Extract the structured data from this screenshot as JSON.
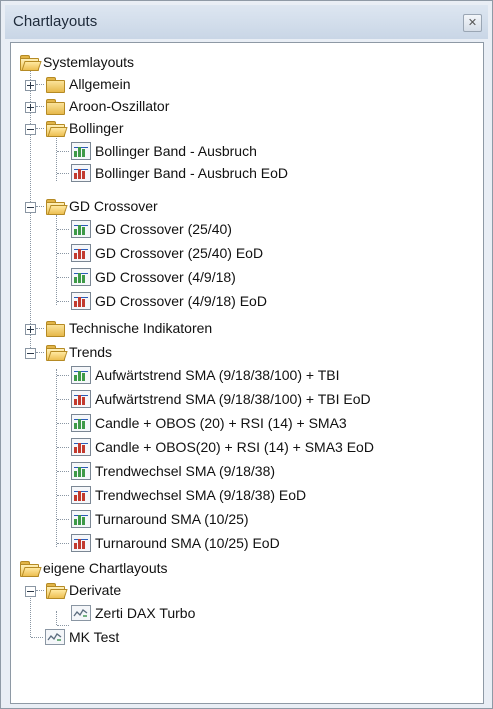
{
  "window": {
    "title": "Chartlayouts"
  },
  "tree": {
    "root_system": "Systemlayouts",
    "allgemein": "Allgemein",
    "aroon": "Aroon-Oszillator",
    "bollinger": {
      "label": "Bollinger",
      "items": [
        "Bollinger Band - Ausbruch",
        "Bollinger Band - Ausbruch EoD"
      ]
    },
    "gd": {
      "label": "GD Crossover",
      "items": [
        "GD Crossover (25/40)",
        "GD Crossover (25/40) EoD",
        "GD Crossover (4/9/18)",
        "GD Crossover (4/9/18) EoD"
      ]
    },
    "technische": "Technische Indikatoren",
    "trends": {
      "label": "Trends",
      "items": [
        "Aufwärtstrend SMA (9/18/38/100) + TBI",
        "Aufwärtstrend SMA (9/18/38/100) + TBI EoD",
        "Candle + OBOS (20) + RSI (14) + SMA3",
        "Candle + OBOS(20) + RSI (14) + SMA3 EoD",
        "Trendwechsel SMA (9/18/38)",
        "Trendwechsel SMA (9/18/38) EoD",
        "Turnaround SMA (10/25)",
        "Turnaround SMA (10/25) EoD"
      ]
    },
    "root_eigene": "eigene Chartlayouts",
    "derivate": {
      "label": "Derivate",
      "items": [
        "Zerti DAX Turbo"
      ]
    },
    "mk_test": "MK Test"
  }
}
